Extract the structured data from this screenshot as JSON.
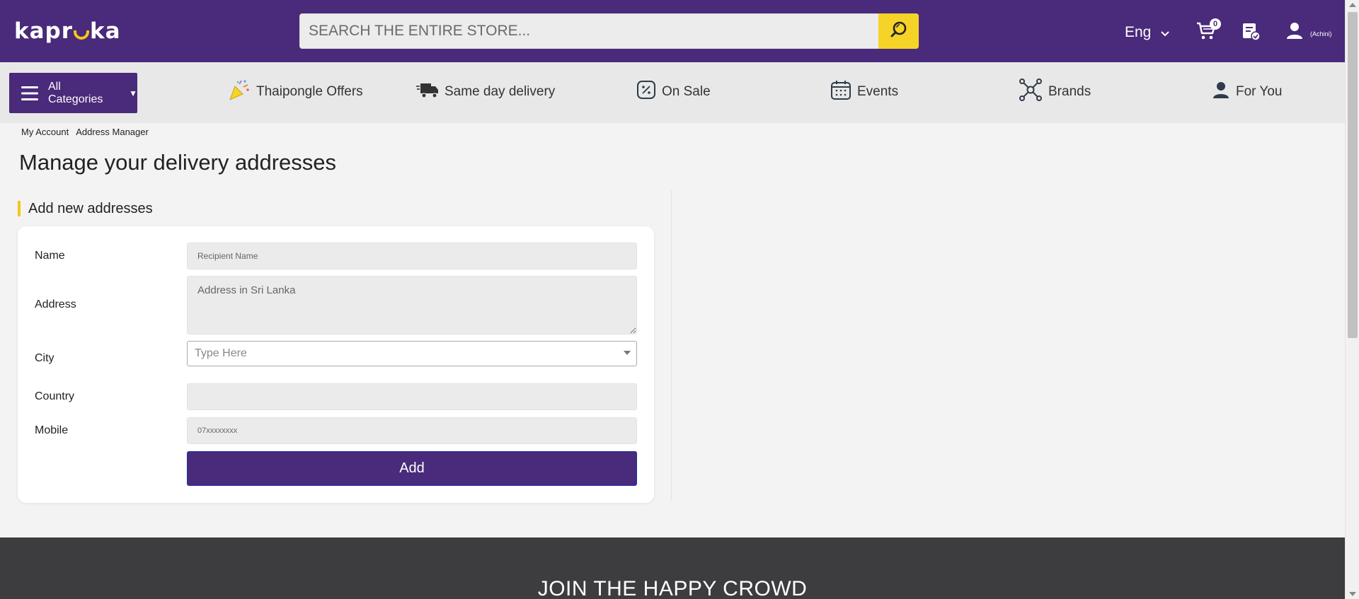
{
  "header": {
    "logo_text_left": "kapr",
    "logo_text_right": "ka",
    "search": {
      "placeholder": "SEARCH THE ENTIRE STORE...",
      "value": ""
    },
    "language": "Eng",
    "cart_count": "0",
    "user_name": "(Achini)",
    "icons": {
      "search": "search-icon",
      "language_dropdown": "chevron-down-icon",
      "cart": "cart-icon",
      "orders": "order-check-icon",
      "user": "user-icon"
    }
  },
  "nav": {
    "all_categories_label": "All Categories",
    "items": [
      {
        "label": "Thaipongle Offers",
        "icon": "party-popper-icon"
      },
      {
        "label": "Same day delivery",
        "icon": "delivery-truck-icon"
      },
      {
        "label": "On Sale",
        "icon": "percent-tag-icon"
      },
      {
        "label": "Events",
        "icon": "calendar-icon"
      },
      {
        "label": "Brands",
        "icon": "network-icon"
      },
      {
        "label": "For You",
        "icon": "person-icon"
      }
    ]
  },
  "breadcrumb": [
    "My Account",
    "Address Manager"
  ],
  "page_title": "Manage your delivery addresses",
  "form": {
    "section_title": "Add new addresses",
    "name_label": "Name",
    "name_placeholder": "Recipient Name",
    "address_label": "Address",
    "address_placeholder": "Address in Sri Lanka",
    "city_label": "City",
    "city_placeholder": "Type Here",
    "country_label": "Country",
    "country_value": "",
    "mobile_label": "Mobile",
    "mobile_placeholder": "07xxxxxxxx",
    "add_button": "Add"
  },
  "footer": {
    "title": "JOIN THE HAPPY CROWD"
  },
  "colors": {
    "brand_purple": "#4a2a7a",
    "accent_yellow": "#f5d327",
    "footer_dark": "#3d3d3f"
  }
}
